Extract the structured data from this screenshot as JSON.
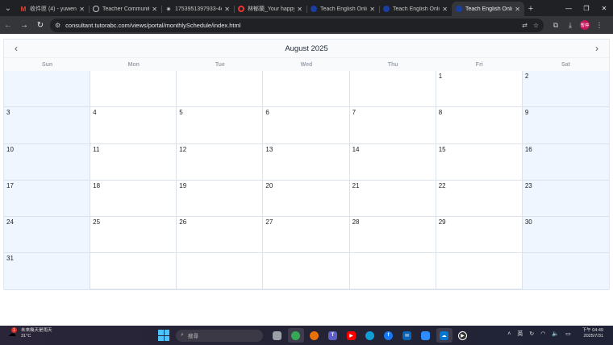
{
  "browser": {
    "tabs": [
      {
        "title": "收件匣 (4) - yuwenb",
        "favicon": "gmail-icon",
        "active": false
      },
      {
        "title": "Teacher Community",
        "favicon": "globe-icon",
        "active": false
      },
      {
        "title": "1753951397933-4c",
        "favicon": "document-icon",
        "active": false
      },
      {
        "title": "林郁蘭_Your happy",
        "favicon": "opera-icon",
        "active": false
      },
      {
        "title": "Teach English Onlin",
        "favicon": "tutorabc-icon",
        "active": false
      },
      {
        "title": "Teach English Onlin",
        "favicon": "tutorabc-icon",
        "active": false
      },
      {
        "title": "Teach English Onlin",
        "favicon": "tutorabc-icon",
        "active": true
      }
    ],
    "url": "consultant.tutorabc.com/views/portal/monthlySchedule/index.html",
    "profile_label": "暫停"
  },
  "calendar": {
    "title": "August 2025",
    "weekdays": [
      "Sun",
      "Mon",
      "Tue",
      "Wed",
      "Thu",
      "Fri",
      "Sat"
    ],
    "weeks": [
      [
        "",
        "",
        "",
        "",
        "",
        "1",
        "2"
      ],
      [
        "3",
        "4",
        "5",
        "6",
        "7",
        "8",
        "9"
      ],
      [
        "10",
        "11",
        "12",
        "13",
        "14",
        "15",
        "16"
      ],
      [
        "17",
        "18",
        "19",
        "20",
        "21",
        "22",
        "23"
      ],
      [
        "24",
        "25",
        "26",
        "27",
        "28",
        "29",
        "30"
      ],
      [
        "31",
        "",
        "",
        "",
        "",
        "",
        ""
      ]
    ],
    "weekend_color": "#eff6ff"
  },
  "taskbar": {
    "weather_desc": "未來幾天是雨天",
    "weather_temp": "31°C",
    "weather_badge": "1",
    "search_placeholder": "搜尋",
    "ime": "英",
    "time": "下午 04:49",
    "date": "2025/7/31"
  }
}
